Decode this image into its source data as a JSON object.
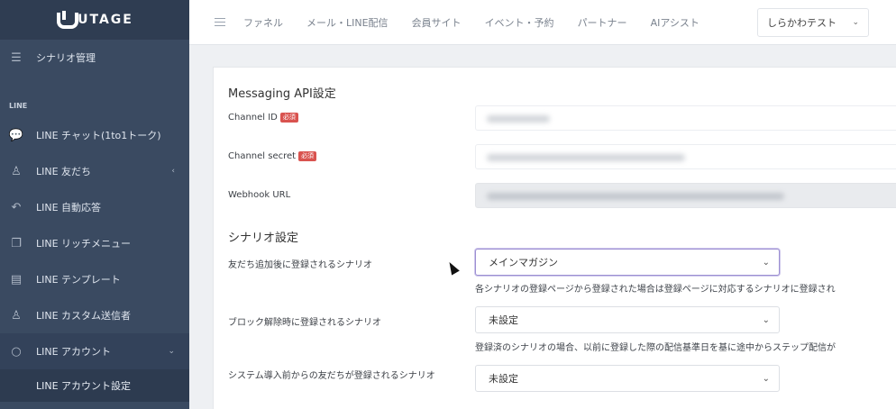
{
  "app": {
    "logo_text": "UTAGE"
  },
  "sidebar": {
    "top_item": {
      "label": "シナリオ管理",
      "icon": "list-icon"
    },
    "section_label": "LINE",
    "items": [
      {
        "label": "LINE チャット(1to1トーク)",
        "icon": "chat-icon"
      },
      {
        "label": "LINE 友だち",
        "icon": "user-icon"
      },
      {
        "label": "LINE 自動応答",
        "icon": "reply-icon"
      },
      {
        "label": "LINE リッチメニュー",
        "icon": "copy-icon"
      },
      {
        "label": "LINE テンプレート",
        "icon": "document-icon"
      },
      {
        "label": "LINE カスタム送信者",
        "icon": "users-icon"
      },
      {
        "label": "LINE アカウント",
        "icon": "search-icon"
      }
    ],
    "sub_item": "LINE アカウント設定"
  },
  "topnav": {
    "items": [
      "ファネル",
      "メール・LINE配信",
      "会員サイト",
      "イベント・予約",
      "パートナー",
      "AIアシスト"
    ],
    "account": "しらかわテスト"
  },
  "form": {
    "messaging_title": "Messaging API設定",
    "required_badge": "必須",
    "channel_id_label": "Channel ID",
    "channel_secret_label": "Channel secret",
    "webhook_label": "Webhook URL",
    "scenario_title": "シナリオ設定",
    "friend_add_label": "友だち追加後に登録されるシナリオ",
    "friend_add_value": "メインマガジン",
    "friend_add_help": "各シナリオの登録ページから登録された場合は登録ページに対応するシナリオに登録され",
    "block_label": "ブロック解除時に登録されるシナリオ",
    "block_value": "未設定",
    "block_help": "登録済のシナリオの場合、以前に登録した際の配信基準日を基に途中からステップ配信が",
    "pre_system_label": "システム導入前からの友だちが登録されるシナリオ",
    "pre_system_value": "未設定"
  }
}
